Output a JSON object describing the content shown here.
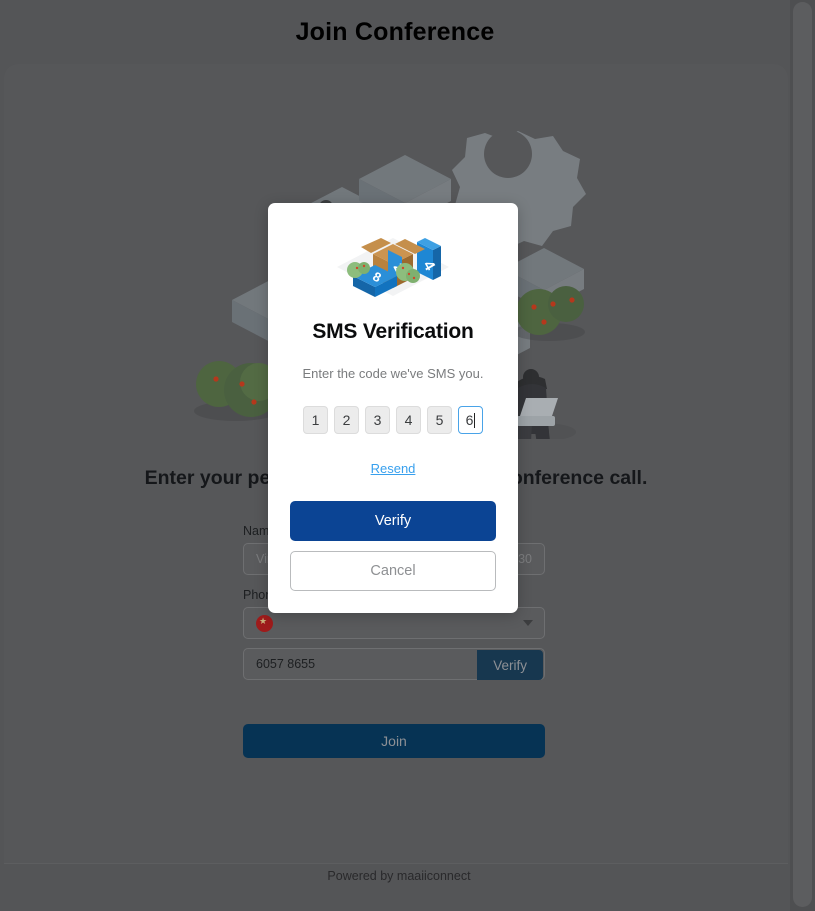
{
  "topbar": {
    "title": "Join Conference"
  },
  "hero": {
    "alt_name": "conference-illustration"
  },
  "page": {
    "headline": "Enter your personal details to join the conference call.",
    "footer_text": "Powered by maaiiconnect"
  },
  "form": {
    "name_label": "Name",
    "name_placeholder": "Vincent",
    "name_counter": "0/30",
    "phone_label": "Phone Number",
    "country_flag": "china-flag-icon",
    "country_caret": "chevron-down-icon",
    "phone_value": "6057 8655",
    "inline_verify_label": "Verify",
    "join_label": "Join"
  },
  "modal": {
    "art_name": "package-blocks-illustration",
    "title": "SMS Verification",
    "subtitle": "Enter the code we've SMS you.",
    "otp": [
      {
        "value": "1",
        "focused": false
      },
      {
        "value": "2",
        "focused": false
      },
      {
        "value": "3",
        "focused": false
      },
      {
        "value": "4",
        "focused": false
      },
      {
        "value": "5",
        "focused": false
      },
      {
        "value": "6",
        "focused": true
      }
    ],
    "resend_label": "Resend",
    "verify_label": "Verify",
    "cancel_label": "Cancel"
  },
  "colors": {
    "overlay_dim": "#545557",
    "primary_blue": "#0b4494",
    "link_blue": "#38a0ee",
    "focus_blue": "#49a3e8",
    "join_blue": "#063354",
    "inline_verify_blue": "#17374f"
  }
}
